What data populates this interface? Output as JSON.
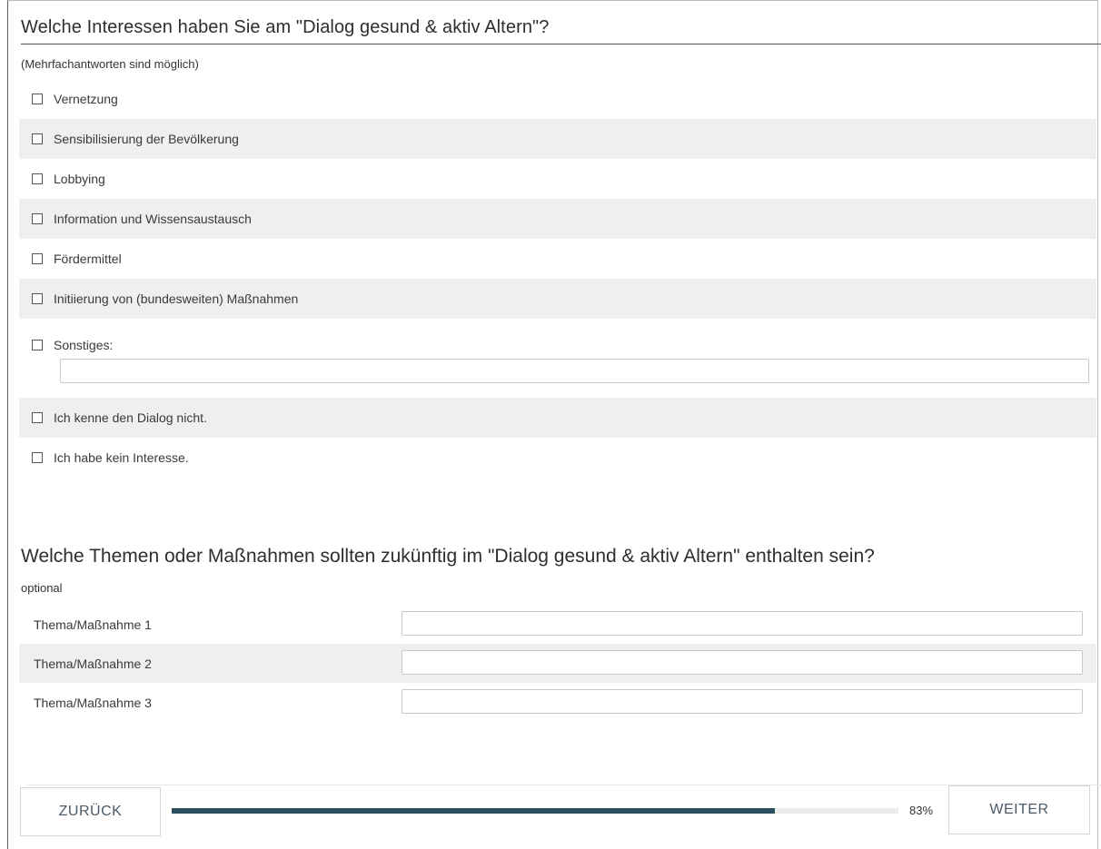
{
  "question1": {
    "title": "Welche Interessen haben Sie am \"Dialog gesund & aktiv Altern\"?",
    "hint": "(Mehrfachantworten sind möglich)",
    "options": [
      {
        "label": "Vernetzung",
        "checked": false
      },
      {
        "label": "Sensibilisierung der Bevölkerung",
        "checked": false
      },
      {
        "label": "Lobbying",
        "checked": false
      },
      {
        "label": "Information und Wissensaustausch",
        "checked": false
      },
      {
        "label": "Fördermittel",
        "checked": false
      },
      {
        "label": "Initiierung von (bundesweiten) Maßnahmen",
        "checked": false
      },
      {
        "label": "Sonstiges:",
        "checked": false,
        "text_value": ""
      },
      {
        "label": "Ich kenne den Dialog nicht.",
        "checked": false
      },
      {
        "label": "Ich habe kein Interesse.",
        "checked": false
      }
    ]
  },
  "question2": {
    "title": "Welche Themen oder Maßnahmen sollten zukünftig im \"Dialog gesund & aktiv Altern\" enthalten sein?",
    "hint": "optional",
    "rows": [
      {
        "label": "Thema/Maßnahme 1",
        "value": ""
      },
      {
        "label": "Thema/Maßnahme 2",
        "value": ""
      },
      {
        "label": "Thema/Maßnahme 3",
        "value": ""
      }
    ]
  },
  "navigation": {
    "back_label": "ZURÜCK",
    "next_label": "WEITER",
    "progress_percent": 83,
    "progress_label": "83%"
  },
  "colors": {
    "progress_fill": "#2c4f5e",
    "row_shade": "#efefef"
  }
}
